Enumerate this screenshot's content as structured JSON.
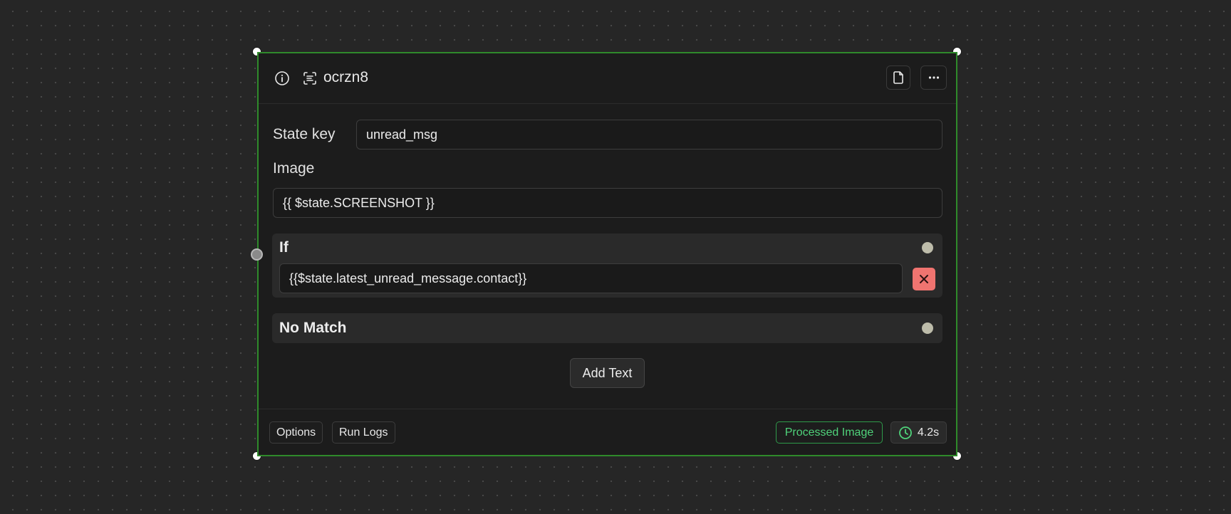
{
  "node": {
    "id": "ocrzn8",
    "icons": {
      "info": "info-icon",
      "type": "ocr-scan-icon",
      "document": "document-icon",
      "more": "more-horizontal-icon",
      "delete": "close-icon",
      "clock": "clock-icon"
    },
    "fields": {
      "state_key_label": "State key",
      "state_key_value": "unread_msg",
      "image_label": "Image",
      "image_value": "{{ $state.SCREENSHOT }}"
    },
    "conditions": {
      "if_label": "If",
      "if_value": "{{$state.latest_unread_message.contact}}",
      "no_match_label": "No Match"
    },
    "add_text_label": "Add Text",
    "footer": {
      "options_label": "Options",
      "run_logs_label": "Run Logs",
      "processed_badge": "Processed Image",
      "duration": "4.2s"
    }
  },
  "colors": {
    "node_border": "#2f8a2b",
    "success_green": "#4fd27a",
    "delete_red": "#f07470",
    "output_handle": "#bdbcaa"
  }
}
